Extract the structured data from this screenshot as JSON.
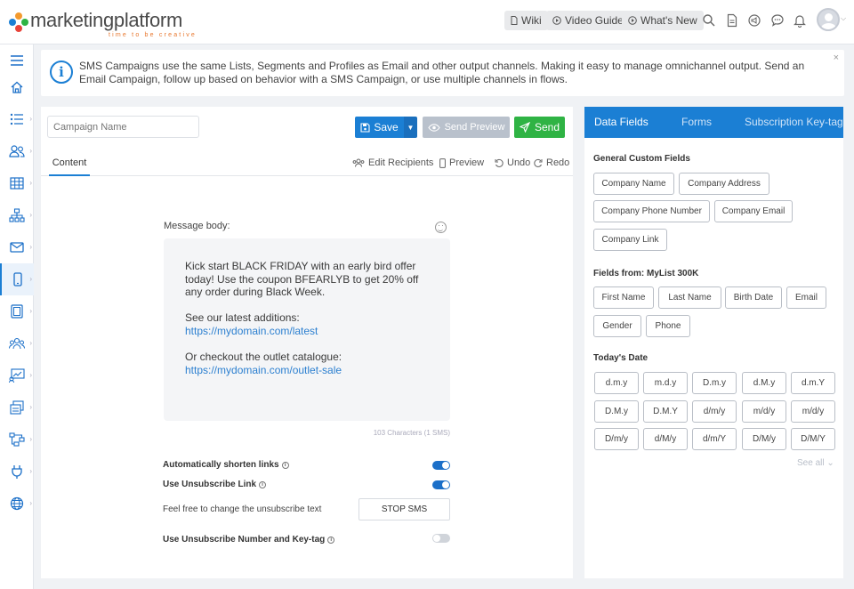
{
  "header": {
    "logo": {
      "word1": "marketing",
      "word2": "platform",
      "tagline": "time to be creative"
    },
    "buttons": {
      "wiki": "Wiki",
      "video_guide": "Video Guide",
      "whats_new": "What's New"
    }
  },
  "sidebar": {
    "items": [
      {
        "name": "menu-toggle",
        "icon": "hamburger-icon"
      },
      {
        "name": "home",
        "icon": "home-icon"
      },
      {
        "name": "lists",
        "icon": "list-icon"
      },
      {
        "name": "subscribers",
        "icon": "users-icon"
      },
      {
        "name": "tables",
        "icon": "grid-icon"
      },
      {
        "name": "segments",
        "icon": "hierarchy-icon"
      },
      {
        "name": "email",
        "icon": "mail-icon"
      },
      {
        "name": "sms",
        "icon": "mobile-icon",
        "active": true
      },
      {
        "name": "pages",
        "icon": "pages-icon"
      },
      {
        "name": "groups",
        "icon": "groups-icon"
      },
      {
        "name": "reports",
        "icon": "chart-icon"
      },
      {
        "name": "forms",
        "icon": "forms-icon"
      },
      {
        "name": "flows",
        "icon": "flow-icon"
      },
      {
        "name": "integrations",
        "icon": "plug-icon"
      },
      {
        "name": "websites",
        "icon": "globe-icon"
      }
    ]
  },
  "banner": {
    "text": "SMS Campaigns use the same Lists, Segments and Profiles as Email and other output channels. Making it easy to manage omnichannel output. Send an Email Campaign, follow up based on behavior with a SMS Campaign, or use multiple channels in flows.",
    "close": "×"
  },
  "editor": {
    "campaign_name_placeholder": "Campaign Name",
    "save": "Save",
    "send_preview": "Send Preview",
    "send": "Send",
    "tab_content": "Content",
    "edit_recipients": "Edit Recipients",
    "preview": "Preview",
    "undo": "Undo",
    "redo": "Redo",
    "message_label": "Message body:",
    "message": {
      "line1": "Kick start BLACK FRIDAY with an early bird offer today! Use the coupon BFEARLYB to get 20% off any order during Black Week.",
      "line2": "See our latest additions:",
      "link1": "https://mydomain.com/latest",
      "line3": "Or checkout the outlet catalogue:",
      "link2": "https://mydomain.com/outlet-sale"
    },
    "char_count": "103 Characters (1 SMS)",
    "options": {
      "shorten_links": {
        "label": "Automatically shorten links",
        "on": true
      },
      "unsubscribe_link": {
        "label": "Use Unsubscribe Link",
        "on": true
      },
      "unsubscribe_text_label": "Feel free to change the unsubscribe text",
      "unsubscribe_text_value": "STOP SMS",
      "unsubscribe_number": {
        "label": "Use Unsubscribe Number and Key-tag",
        "on": false
      }
    }
  },
  "right_panel": {
    "tabs": [
      "Data Fields",
      "Forms",
      "Subscription Key-tag"
    ],
    "general_heading": "General Custom Fields",
    "general_fields": [
      "Company Name",
      "Company Address",
      "Company Phone Number",
      "Company Email",
      "Company Link"
    ],
    "list_heading": "Fields from: MyList 300K",
    "list_fields": [
      "First Name",
      "Last Name",
      "Birth Date",
      "Email",
      "Gender",
      "Phone"
    ],
    "date_heading": "Today's Date",
    "date_formats": [
      "d.m.y",
      "m.d.y",
      "D.m.y",
      "d.M.y",
      "d.m.Y",
      "D.M.y",
      "D.M.Y",
      "d/m/y",
      "m/d/y",
      "m/d/y",
      "D/m/y",
      "d/M/y",
      "d/m/Y",
      "D/M/y",
      "D/M/Y"
    ],
    "see_all": "See all"
  },
  "colors": {
    "accent": "#1b7fd4",
    "send_green": "#2fb344",
    "logo_orange": "#e8772e"
  }
}
